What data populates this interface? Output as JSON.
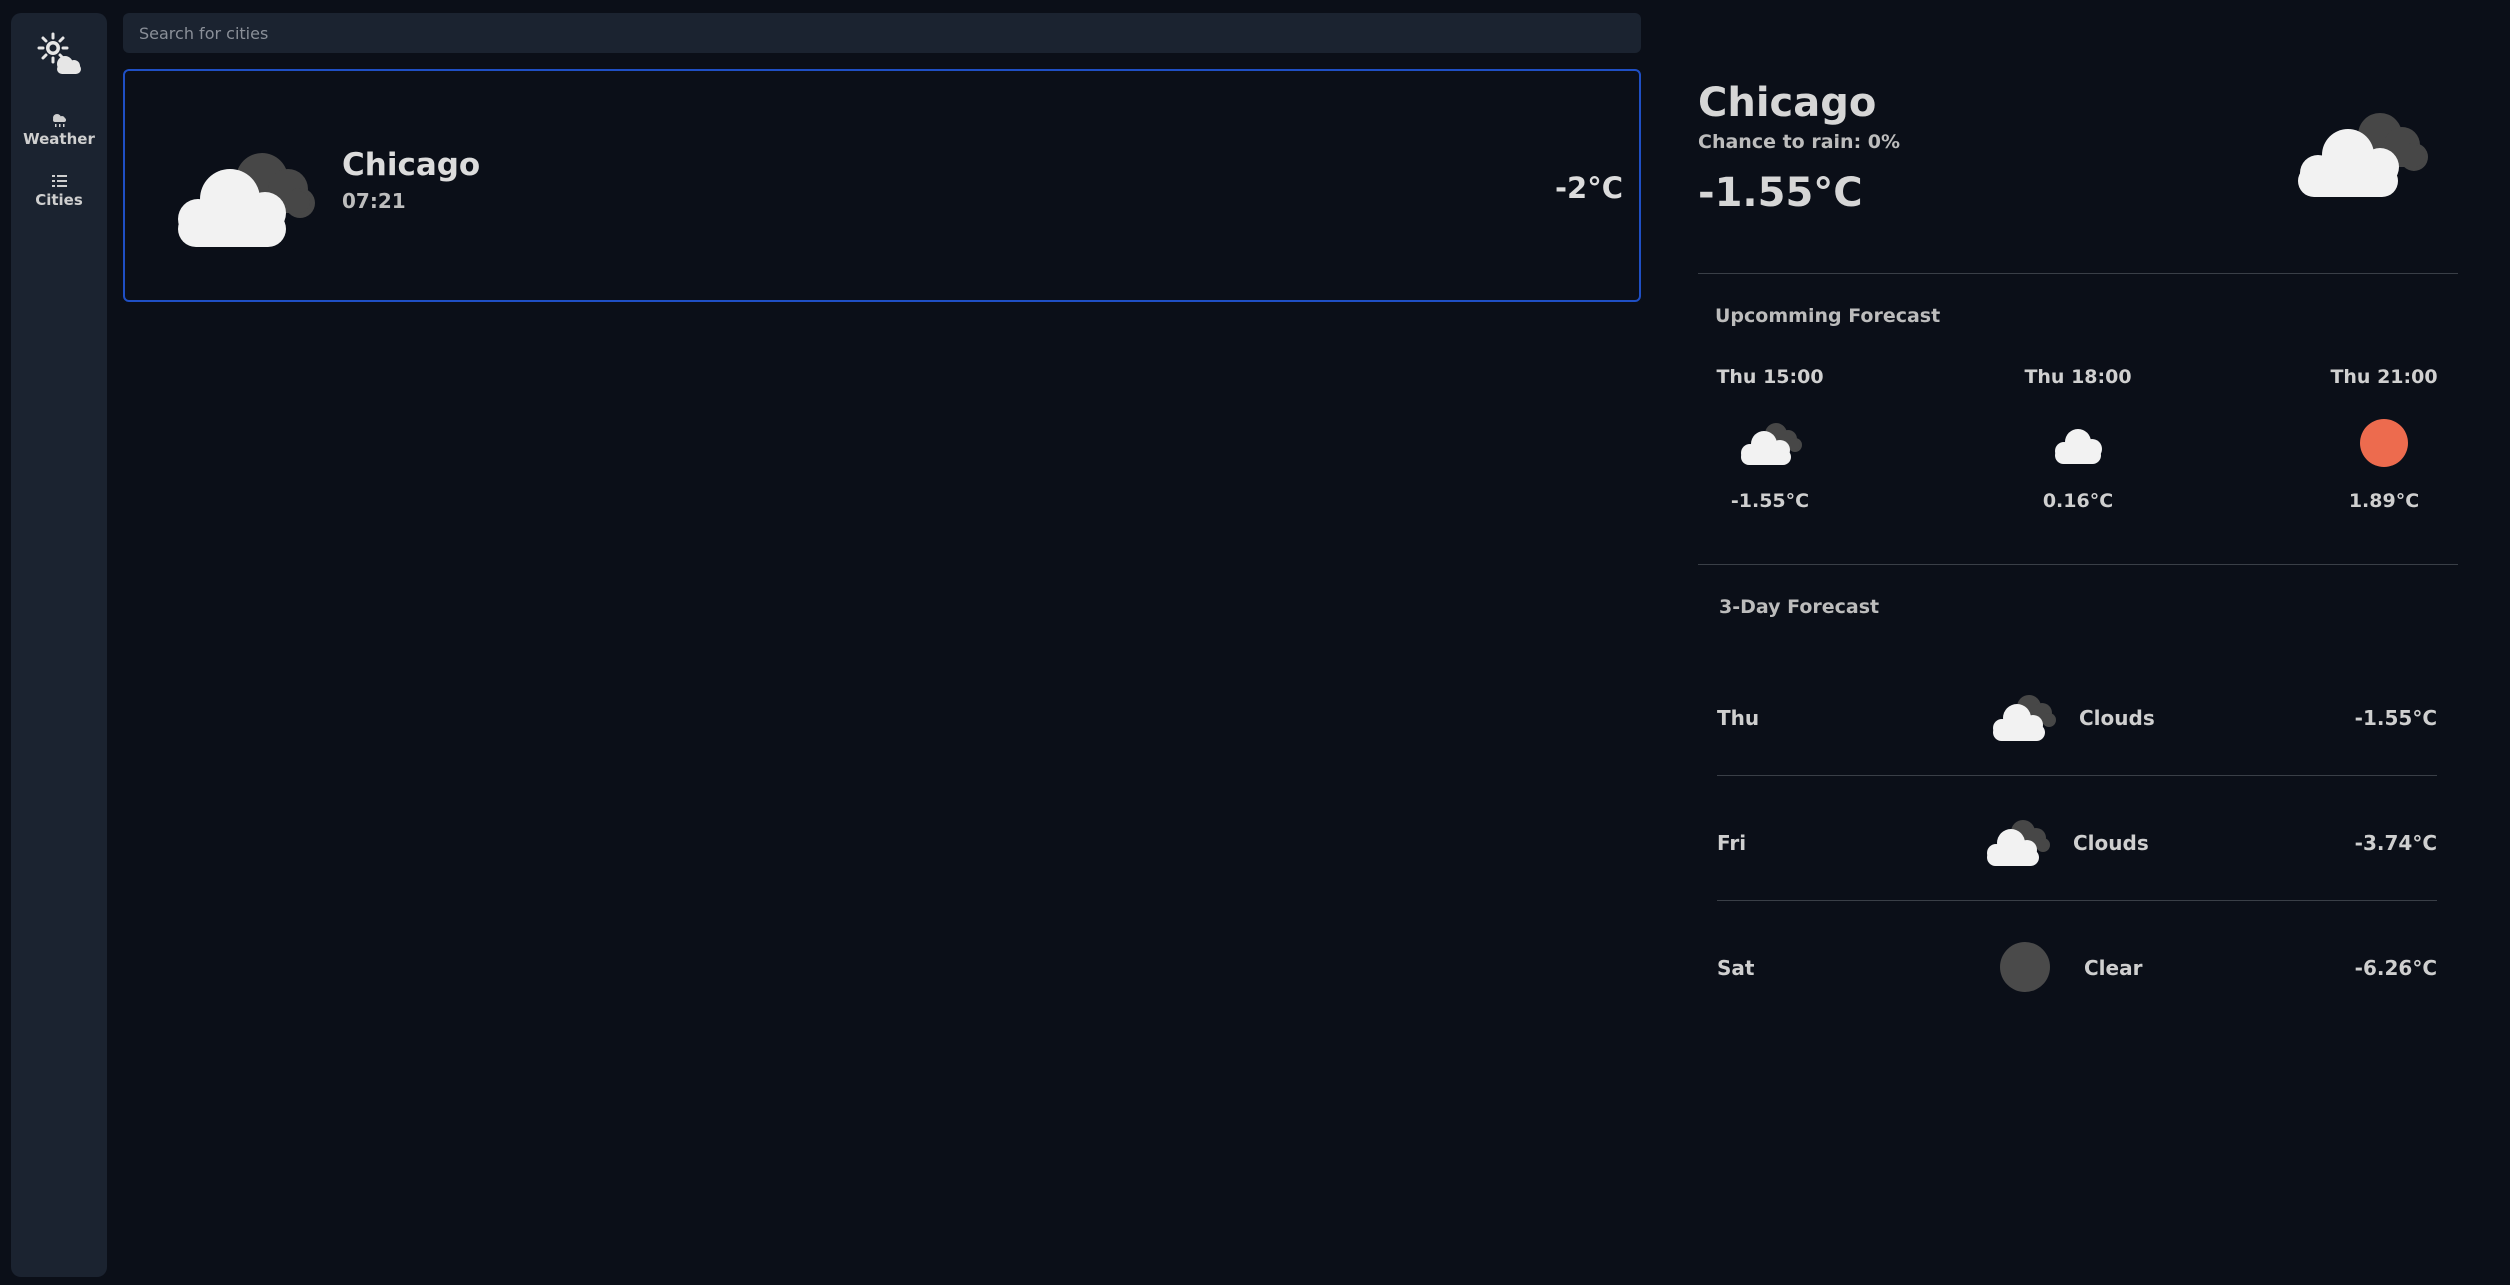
{
  "sidebar": {
    "logo_icon": "sun-cloud-logo",
    "items": [
      {
        "label": "Weather",
        "icon": "cloud-rain-icon"
      },
      {
        "label": "Cities",
        "icon": "list-icon"
      }
    ]
  },
  "search": {
    "placeholder": "Search for cities",
    "value": ""
  },
  "city_card": {
    "city": "Chicago",
    "time": "07:21",
    "temp": "-2°C",
    "icon": "clouds-icon"
  },
  "current": {
    "city": "Chicago",
    "chance_of_rain": "Chance to rain: 0%",
    "temp": "-1.55°C",
    "icon": "clouds-icon"
  },
  "upcoming": {
    "title": "Upcomming Forecast",
    "hours": [
      {
        "time": "Thu 15:00",
        "temp": "-1.55°C",
        "icon": "clouds-icon"
      },
      {
        "time": "Thu 18:00",
        "temp": "0.16°C",
        "icon": "cloud-icon"
      },
      {
        "time": "Thu 21:00",
        "temp": "1.89°C",
        "icon": "sun-icon"
      }
    ]
  },
  "three_day": {
    "title": "3-Day Forecast",
    "days": [
      {
        "day": "Thu",
        "condition": "Clouds",
        "temp": "-1.55°C",
        "icon": "clouds-icon"
      },
      {
        "day": "Fri",
        "condition": "Clouds",
        "temp": "-3.74°C",
        "icon": "clouds-icon"
      },
      {
        "day": "Sat",
        "condition": "Clear",
        "temp": "-6.26°C",
        "icon": "moon-icon"
      }
    ]
  },
  "colors": {
    "background": "#0b0f18",
    "panel": "#1b2330",
    "accent": "#1f4fc4",
    "sun": "#ed6b4e",
    "moon": "#4a4a4a"
  }
}
